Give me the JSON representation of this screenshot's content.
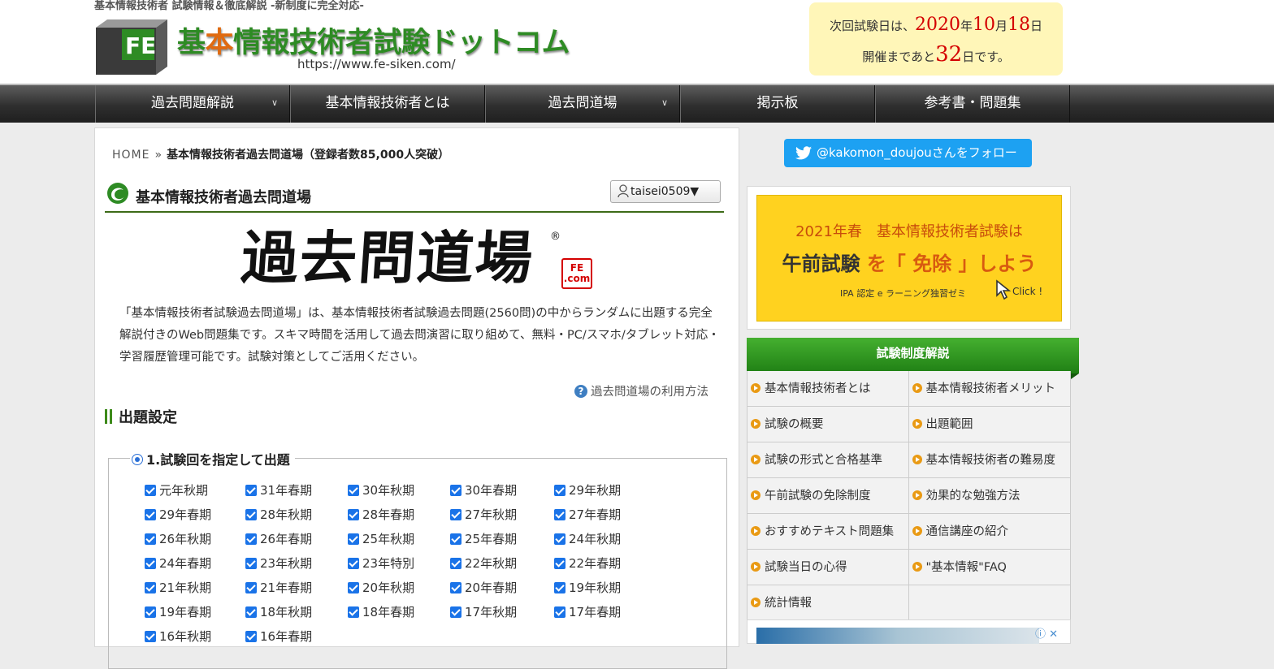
{
  "header": {
    "tagline": "基本情報技術者 試験情報＆徹底解説 -新制度に完全対応-",
    "logo_letters": "FE",
    "title_part1": "基",
    "title_highlight": "本",
    "title_part2": "情報技術者試験ドットコム",
    "url": "https://www.fe-siken.com/",
    "exam": {
      "prefix": "次回試験日は、",
      "year": "2020",
      "year_unit": "年",
      "month": "10",
      "month_unit": "月",
      "day": "18",
      "day_unit": "日",
      "countdown_prefix": "開催まであと",
      "days_left": "32",
      "countdown_suffix": "日です。"
    }
  },
  "nav": {
    "items": [
      {
        "label": "過去問題解説",
        "has_dropdown": true
      },
      {
        "label": "基本情報技術者とは",
        "has_dropdown": false
      },
      {
        "label": "過去問道場",
        "has_dropdown": true
      },
      {
        "label": "掲示板",
        "has_dropdown": false
      },
      {
        "label": "参考書・問題集",
        "has_dropdown": false
      }
    ],
    "caret": "∨"
  },
  "breadcrumb": {
    "home": "HOME",
    "separator": "»",
    "current": "基本情報技術者過去問道場（登録者数85,000人突破）"
  },
  "main": {
    "page_title": "基本情報技術者過去問道場",
    "user_button": "taisei0509▼",
    "logo_text": "過去問道場",
    "logo_reg": "®",
    "stamp_line1": "FE",
    "stamp_line2": ".com",
    "intro": "「基本情報技術者試験過去問道場」は、基本情報技術者試験過去問題(2560問)の中からランダムに出題する完全解説付きのWeb問題集です。スキマ時間を活用して過去問演習に取り組めて、無料・PC/スマホ/タブレット対応・学習履歴管理可能です。試験対策としてご活用ください。",
    "howto_icon": "?",
    "howto_label": "過去問道場の利用方法",
    "settings_heading": "出題設定",
    "option1_label": "1.試験回を指定して出題",
    "exam_sessions": [
      {
        "label": "元年秋期",
        "checked": true
      },
      {
        "label": "31年春期",
        "checked": true
      },
      {
        "label": "30年秋期",
        "checked": true
      },
      {
        "label": "30年春期",
        "checked": true
      },
      {
        "label": "29年秋期",
        "checked": true
      },
      {
        "label": "29年春期",
        "checked": true
      },
      {
        "label": "28年秋期",
        "checked": true
      },
      {
        "label": "28年春期",
        "checked": true
      },
      {
        "label": "27年秋期",
        "checked": true
      },
      {
        "label": "27年春期",
        "checked": true
      },
      {
        "label": "26年秋期",
        "checked": true
      },
      {
        "label": "26年春期",
        "checked": true
      },
      {
        "label": "25年秋期",
        "checked": true
      },
      {
        "label": "25年春期",
        "checked": true
      },
      {
        "label": "24年秋期",
        "checked": true
      },
      {
        "label": "24年春期",
        "checked": true
      },
      {
        "label": "23年秋期",
        "checked": true
      },
      {
        "label": "23年特別",
        "checked": true
      },
      {
        "label": "22年秋期",
        "checked": true
      },
      {
        "label": "22年春期",
        "checked": true
      },
      {
        "label": "21年秋期",
        "checked": true
      },
      {
        "label": "21年春期",
        "checked": true
      },
      {
        "label": "20年秋期",
        "checked": true
      },
      {
        "label": "20年春期",
        "checked": true
      },
      {
        "label": "19年秋期",
        "checked": true
      },
      {
        "label": "19年春期",
        "checked": true
      },
      {
        "label": "18年秋期",
        "checked": true
      },
      {
        "label": "18年春期",
        "checked": true
      },
      {
        "label": "17年秋期",
        "checked": true
      },
      {
        "label": "17年春期",
        "checked": true
      },
      {
        "label": "16年秋期",
        "checked": true
      },
      {
        "label": "16年春期",
        "checked": true
      }
    ]
  },
  "sidebar": {
    "twitter_label": "@kakomon_doujouさんをフォロー",
    "ad": {
      "line1": "2021年春　基本情報技術者試験は",
      "line2_a": "午前試験",
      "line2_b": "を「",
      "line2_c": "免除",
      "line2_d": "」しよう",
      "line3": "IPA 認定 e ラーニング独習ゼミ",
      "click": "Click !"
    },
    "system_heading": "試験制度解説",
    "system_links": [
      "基本情報技術者とは",
      "基本情報技術者メリット",
      "試験の概要",
      "出題範囲",
      "試験の形式と合格基準",
      "基本情報技術者の難易度",
      "午前試験の免除制度",
      "効果的な勉強方法",
      "おすすめテキスト問題集",
      "通信講座の紹介",
      "試験当日の心得",
      "\"基本情報\"FAQ",
      "統計情報",
      ""
    ],
    "ad2_close": "ⓘ ✕"
  },
  "colors": {
    "brand_green": "#2e8b24",
    "brand_orange": "#e06a10",
    "checkbox_blue": "#1a73e8",
    "twitter_blue": "#1da1f2",
    "countdown_red": "#d40000"
  }
}
